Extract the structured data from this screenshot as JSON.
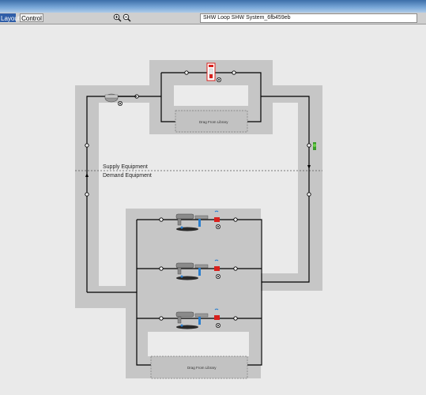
{
  "toolbar": {
    "tabs": [
      {
        "label": "Layout",
        "active": true
      },
      {
        "label": "Control",
        "active": false
      }
    ],
    "zoom_in_icon": "magnifier-plus",
    "zoom_out_icon": "magnifier-minus",
    "loop_name": "SHW Loop SHW System_6fb459eb"
  },
  "diagram": {
    "supply_label": "Supply Equipment",
    "demand_label": "Demand Equipment",
    "supply_drop_label": "Drag From Library",
    "demand_drop_label": "Drag From Library",
    "components": [
      {
        "name": "water-heater",
        "icon": "water-heater-icon"
      },
      {
        "name": "pump",
        "icon": "pump-icon"
      },
      {
        "name": "setpoint-manager",
        "icon": "setpoint-manager-icon"
      },
      {
        "name": "water-use-connection-1",
        "icon": "faucet-icon"
      },
      {
        "name": "water-use-connection-2",
        "icon": "faucet-icon"
      },
      {
        "name": "water-use-connection-3",
        "icon": "faucet-icon"
      }
    ]
  },
  "colors": {
    "titlebar": "#4f80bd",
    "active_tab": "#2f5ea8",
    "background": "#eaeaea",
    "loop_band": "#c6c6c6",
    "pipe": "#000000",
    "heater_red": "#d8201c",
    "setpoint_green": "#3a9a2a",
    "faucet_blue": "#2a7fd0"
  }
}
